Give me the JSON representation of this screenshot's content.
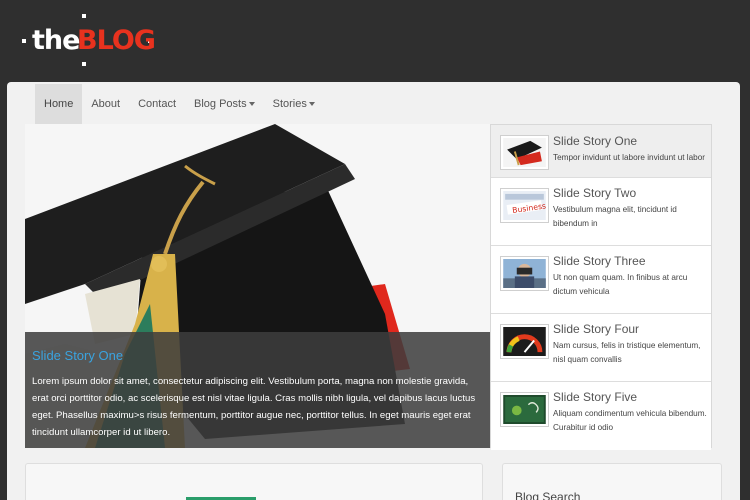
{
  "logo": {
    "part1": "the",
    "part2": "BLOG"
  },
  "nav": {
    "items": [
      {
        "label": "Home"
      },
      {
        "label": "About"
      },
      {
        "label": "Contact"
      },
      {
        "label": "Blog Posts"
      },
      {
        "label": "Stories"
      }
    ]
  },
  "slider": {
    "caption_title": "Slide Story One",
    "caption_text": "Lorem ipsum dolor sit amet, consectetur adipiscing elit. Vestibulum porta, magna non molestie gravida, erat orci porttitor odio, ac scelerisque est nisl vitae ligula. Cras mollis nibh ligula, vel dapibus lacus luctus eget. Phasellus maximu>s risus fermentum, porttitor augue nec, porttitor tellus. In eget mauris eget erat tincidunt ullamcorper id ut libero."
  },
  "stories": [
    {
      "title": "Slide Story One",
      "text": "Tempor invidunt ut labore invidunt ut labor",
      "icon": "graduation-cap-thumb"
    },
    {
      "title": "Slide Story Two",
      "text": "Vestibulum magna elit, tincidunt id bibendum in",
      "icon": "business-thumb"
    },
    {
      "title": "Slide Story Three",
      "text": "Ut non quam quam. In finibus at arcu dictum vehicula",
      "icon": "binoculars-thumb"
    },
    {
      "title": "Slide Story Four",
      "text": "Nam cursus, felis in tristique elementum, nisl quam convallis",
      "icon": "speedometer-thumb"
    },
    {
      "title": "Slide Story Five",
      "text": "Aliquam condimentum vehicula bibendum. Curabitur id odio",
      "icon": "chalkboard-thumb"
    }
  ],
  "sidebar": {
    "search_title": "Blog Search"
  },
  "colors": {
    "brand": "#e8321e",
    "caption_title": "#3aa3df",
    "background": "#2f2f2f",
    "panel": "#f1f1f1"
  }
}
